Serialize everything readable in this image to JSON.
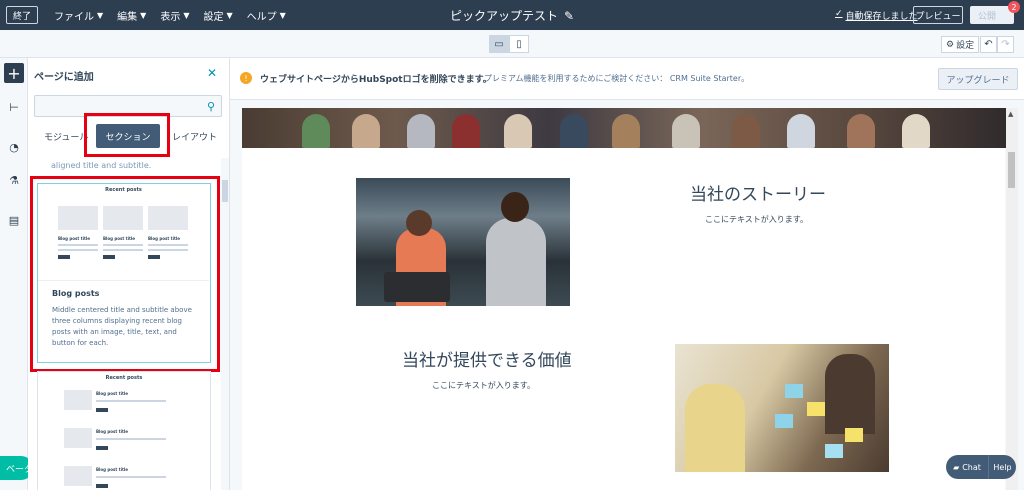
{
  "topbar": {
    "exit_label": "終了",
    "menus": [
      "ファイル",
      "編集",
      "表示",
      "設定",
      "ヘルプ"
    ],
    "page_title": "ピックアップテスト",
    "autosave_label": "自動保存しました",
    "preview_label": "プレビュー",
    "publish_label": "公開",
    "badge_count": "2"
  },
  "toolbar": {
    "settings_label": "設定"
  },
  "panel": {
    "title": "ページに追加",
    "search_placeholder": "",
    "tabs": [
      "モジュール",
      "セクション",
      "レイアウト"
    ],
    "active_tab": "セクション",
    "cut_text": "aligned title and subtitle.",
    "card": {
      "preview_title": "Recent posts",
      "post_title": "Blog post title",
      "name": "Blog posts",
      "description": "Middle centered title and subtitle above three columns displaying recent blog posts with an image, title, text, and button for each."
    },
    "card2": {
      "preview_title": "Recent posts",
      "post_title": "Blog post title"
    }
  },
  "banner": {
    "main_text": "ウェブサイトページからHubSpotロゴを削除できます。",
    "sub_text": "プレミアム機能を利用するためにご検討ください： CRM Suite Starter。",
    "upgrade_label": "アップグレード"
  },
  "content": {
    "story_title": "当社のストーリー",
    "story_text": "ここにテキストが入ります。",
    "value_title": "当社が提供できる価値",
    "value_text": "ここにテキストが入ります。"
  },
  "beta_label": "ベータ",
  "chat_label": "Chat",
  "help_label": "Help",
  "colors": {
    "topbar": "#2d3e50",
    "highlight": "#e60012",
    "accent": "#0091ae",
    "active_tab": "#425b76",
    "beta": "#00bda5"
  }
}
